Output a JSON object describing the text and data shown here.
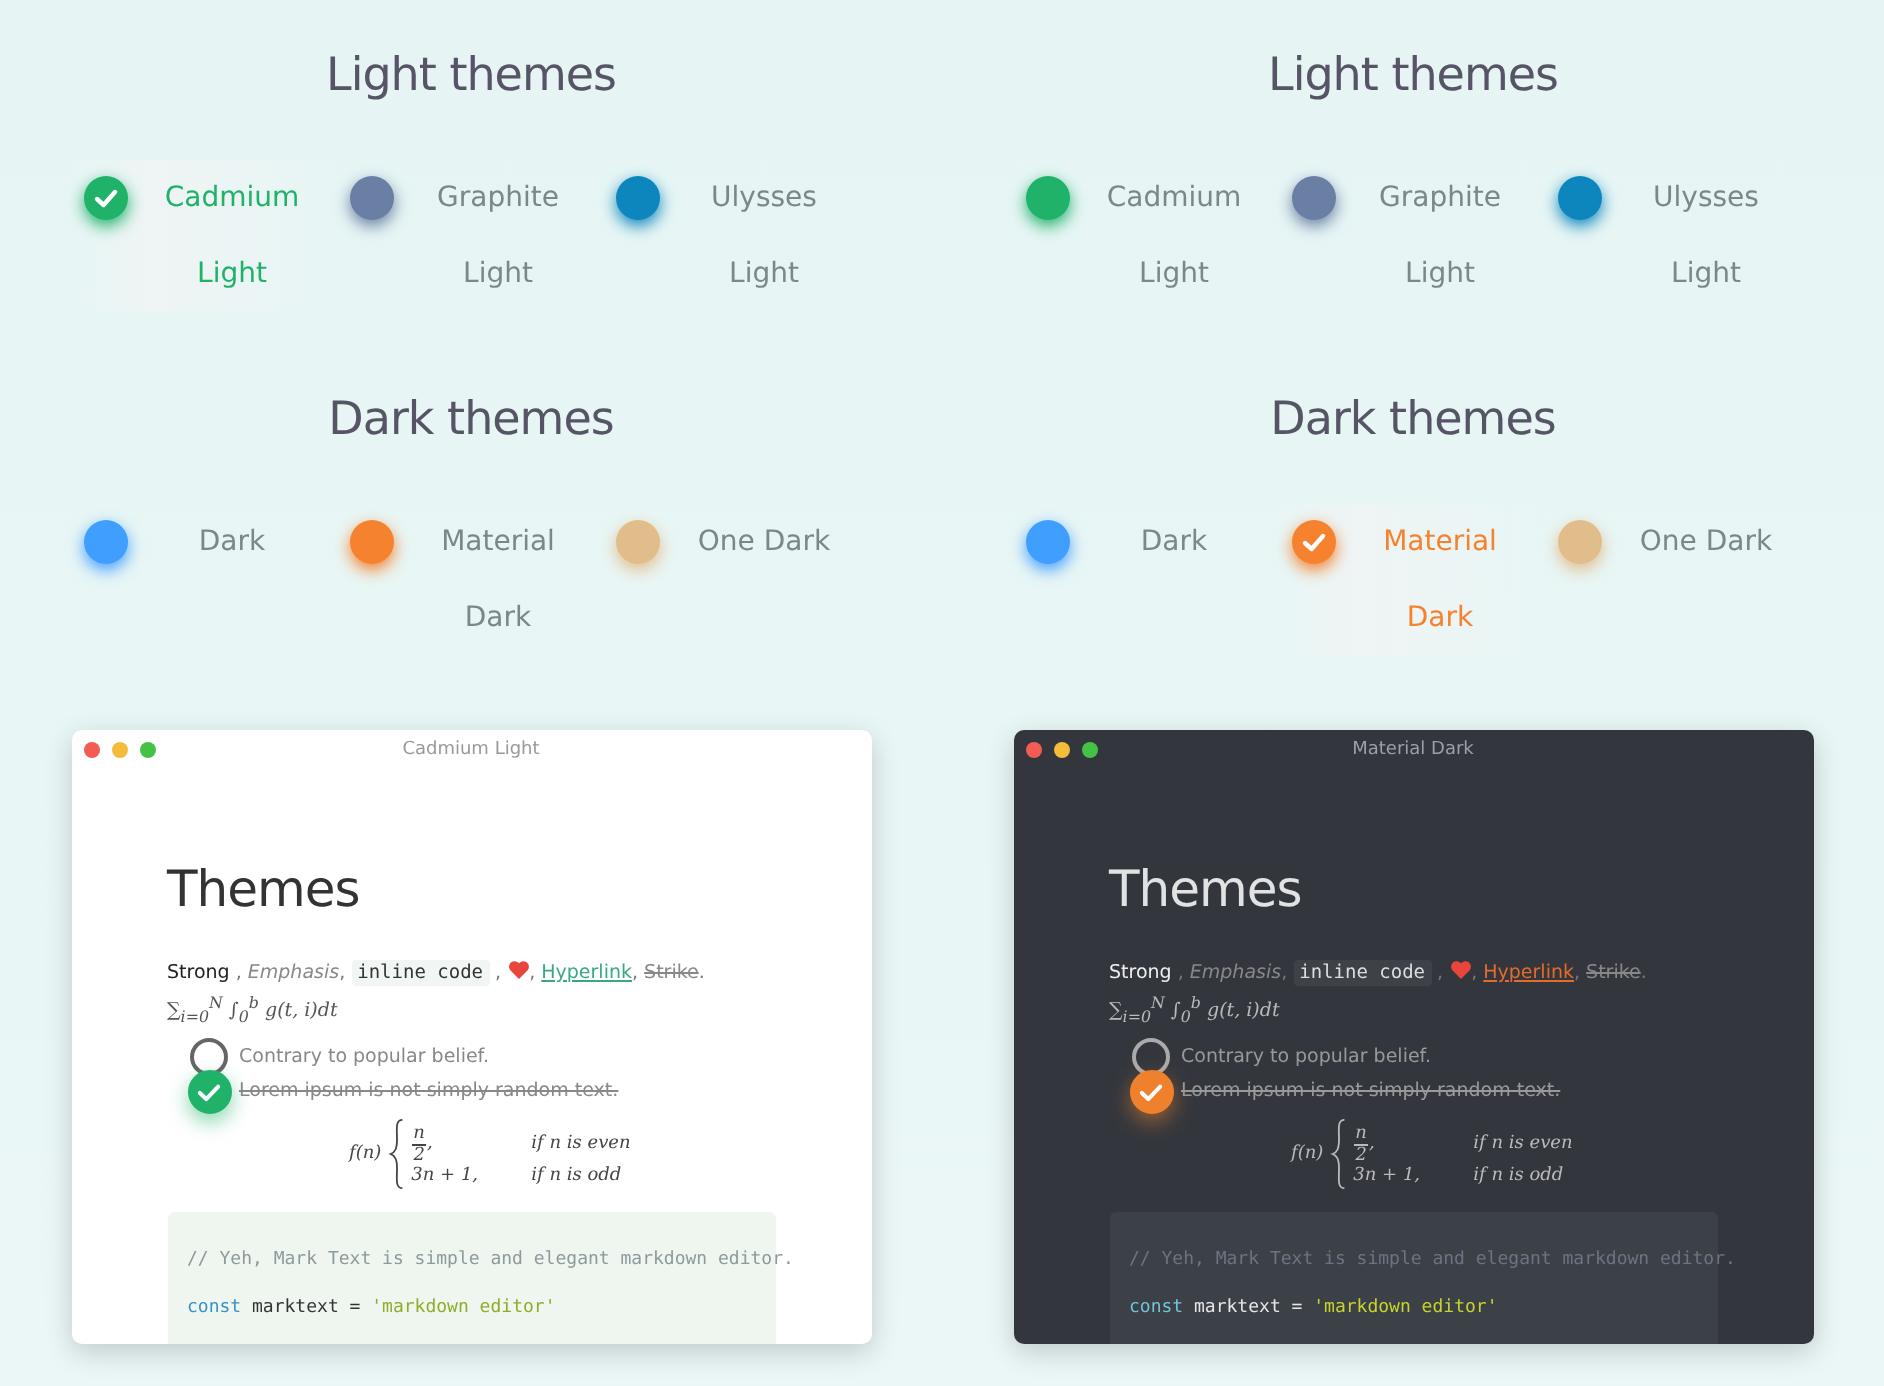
{
  "panels": [
    {
      "theme_groups": [
        {
          "title": "Light themes",
          "themes": [
            {
              "label": "Cadmium Light",
              "color": "#21b26a",
              "selected": true
            },
            {
              "label": "Graphite Light",
              "color": "#6a7fa4",
              "selected": false
            },
            {
              "label": "Ulysses Light",
              "color": "#0d86bd",
              "selected": false
            }
          ]
        },
        {
          "title": "Dark themes",
          "themes": [
            {
              "label": "Dark",
              "color": "#409eff",
              "selected": false
            },
            {
              "label": "Material Dark",
              "color": "#f5822f",
              "selected": false
            },
            {
              "label": "One Dark",
              "color": "#e2bd8c",
              "selected": false
            }
          ]
        }
      ],
      "preview": {
        "dark": false,
        "title": "Cadmium Light",
        "heading": "Themes",
        "inline": [
          {
            "kind": "strong",
            "text": "Strong"
          },
          {
            "kind": "plain",
            "text": " , "
          },
          {
            "kind": "em",
            "text": "Emphasis"
          },
          {
            "kind": "plain",
            "text": ", "
          },
          {
            "kind": "code",
            "text": "inline code"
          },
          {
            "kind": "plain",
            "text": " , "
          },
          {
            "kind": "heart"
          },
          {
            "kind": "plain",
            "text": ", "
          },
          {
            "kind": "link",
            "text": "Hyperlink"
          },
          {
            "kind": "plain",
            "text": ", "
          },
          {
            "kind": "strike",
            "text": "Strike"
          },
          {
            "kind": "plain",
            "text": "."
          }
        ],
        "math": "∑$_{i=0}$$^{N}$ ∫$_{0}$$^{b}$ g(t, i)dt",
        "tasks": [
          {
            "text": "Contrary to popular belief.",
            "checked": false
          },
          {
            "text": "Lorem ipsum is not simply random text.",
            "checked": true
          }
        ],
        "formula": {
          "lhs": "f(n)",
          "cases": [
            {
              "kind": "fraction",
              "numerator": "n",
              "denominator": "2",
              "suffix": ",",
              "condition": "if n is even"
            },
            {
              "kind": "expr",
              "expr": "3n + 1,",
              "condition": "if n is odd"
            }
          ]
        },
        "code": [
          [
            {
              "kind": "comment",
              "text": "// Yeh, Mark Text is simple and elegant markdown editor."
            }
          ],
          [
            {
              "kind": "keyword",
              "text": "const"
            },
            {
              "kind": "plain",
              "text": " marktext = "
            },
            {
              "kind": "string",
              "text": "'markdown editor'"
            }
          ]
        ]
      }
    },
    {
      "theme_groups": [
        {
          "title": "Light themes",
          "themes": [
            {
              "label": "Cadmium Light",
              "color": "#21b26a",
              "selected": false
            },
            {
              "label": "Graphite Light",
              "color": "#6a7fa4",
              "selected": false
            },
            {
              "label": "Ulysses Light",
              "color": "#0d86bd",
              "selected": false
            }
          ]
        },
        {
          "title": "Dark themes",
          "themes": [
            {
              "label": "Dark",
              "color": "#409eff",
              "selected": false
            },
            {
              "label": "Material Dark",
              "color": "#f5822f",
              "selected": true
            },
            {
              "label": "One Dark",
              "color": "#e2bd8c",
              "selected": false
            }
          ]
        }
      ],
      "preview": {
        "dark": true,
        "title": "Material Dark",
        "heading": "Themes",
        "inline": [
          {
            "kind": "strong",
            "text": "Strong"
          },
          {
            "kind": "plain",
            "text": " , "
          },
          {
            "kind": "em",
            "text": "Emphasis"
          },
          {
            "kind": "plain",
            "text": ", "
          },
          {
            "kind": "code",
            "text": "inline code"
          },
          {
            "kind": "plain",
            "text": " , "
          },
          {
            "kind": "heart"
          },
          {
            "kind": "plain",
            "text": ", "
          },
          {
            "kind": "link",
            "text": "Hyperlink"
          },
          {
            "kind": "plain",
            "text": ", "
          },
          {
            "kind": "strike",
            "text": "Strike"
          },
          {
            "kind": "plain",
            "text": "."
          }
        ],
        "math": "∑$_{i=0}$$^{N}$ ∫$_{0}$$^{b}$ g(t, i)dt",
        "tasks": [
          {
            "text": "Contrary to popular belief.",
            "checked": false
          },
          {
            "text": "Lorem ipsum is not simply random text.",
            "checked": true
          }
        ],
        "formula": {
          "lhs": "f(n)",
          "cases": [
            {
              "kind": "fraction",
              "numerator": "n",
              "denominator": "2",
              "suffix": ",",
              "condition": "if n is even"
            },
            {
              "kind": "expr",
              "expr": "3n + 1,",
              "condition": "if n is odd"
            }
          ]
        },
        "code": [
          [
            {
              "kind": "comment",
              "text": "// Yeh, Mark Text is simple and elegant markdown editor."
            }
          ],
          [
            {
              "kind": "keyword",
              "text": "const"
            },
            {
              "kind": "plain",
              "text": " marktext = "
            },
            {
              "kind": "string",
              "text": "'markdown editor'"
            }
          ]
        ]
      }
    }
  ]
}
